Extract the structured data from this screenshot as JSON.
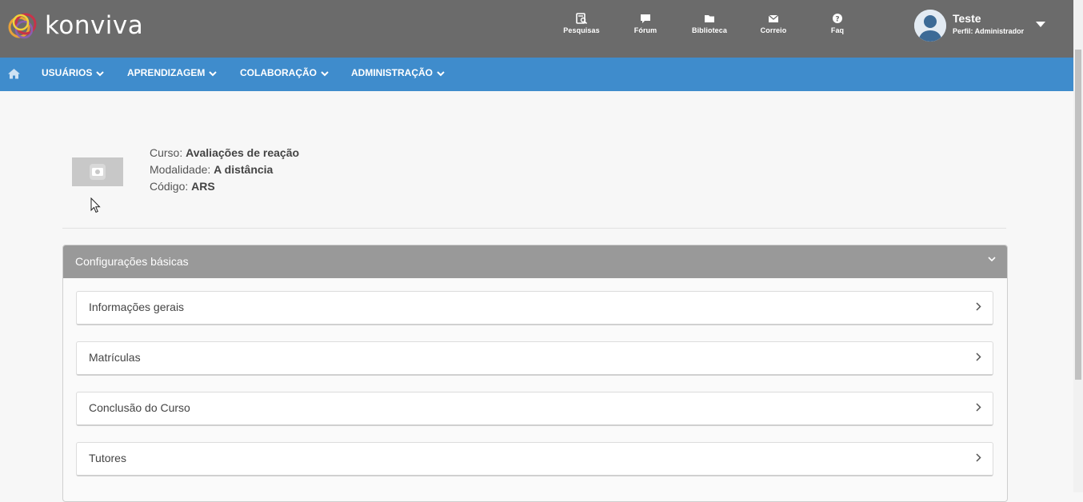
{
  "brand": {
    "name": "konviva"
  },
  "header": {
    "quick_links": [
      {
        "label": "Pesquisas",
        "icon": "survey-icon"
      },
      {
        "label": "Fórum",
        "icon": "chat-icon"
      },
      {
        "label": "Biblioteca",
        "icon": "folder-icon"
      },
      {
        "label": "Correio",
        "icon": "envelope-icon"
      },
      {
        "label": "Faq",
        "icon": "question-icon"
      }
    ],
    "user": {
      "name": "Teste",
      "profile": "Perfil: Administrador"
    }
  },
  "nav": {
    "home_icon": "home-icon",
    "items": [
      {
        "label": "USUÁRIOS"
      },
      {
        "label": "APRENDIZAGEM"
      },
      {
        "label": "COLABORAÇÃO"
      },
      {
        "label": "ADMINISTRAÇÃO"
      }
    ]
  },
  "course": {
    "course_label": "Curso:",
    "course_value": "Avaliações de reação",
    "modality_label": "Modalidade:",
    "modality_value": "A distância",
    "code_label": "Código:",
    "code_value": "ARS"
  },
  "accordion": {
    "title": "Configurações básicas",
    "sections": [
      {
        "label": "Informações gerais"
      },
      {
        "label": "Matrículas"
      },
      {
        "label": "Conclusão do Curso"
      },
      {
        "label": "Tutores"
      }
    ]
  },
  "colors": {
    "header_bg": "#6b6b6b",
    "nav_bg": "#3f8ccc",
    "panel_head_bg": "#999999",
    "page_bg": "#f7f7f7"
  }
}
